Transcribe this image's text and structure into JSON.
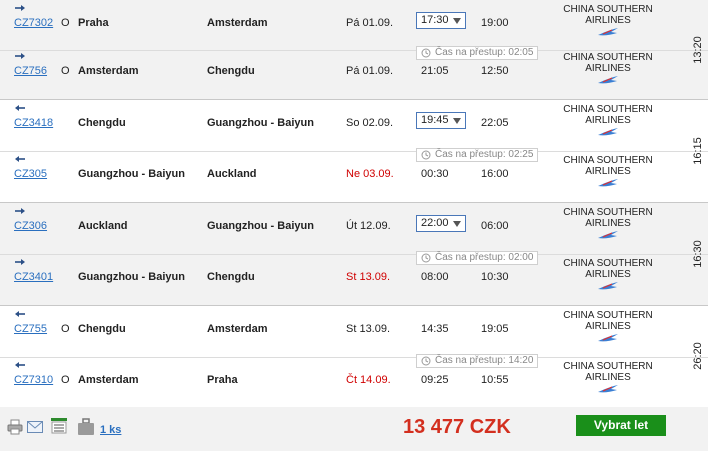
{
  "airline_name": "CHINA SOUTHERN AIRLINES",
  "transfer_label": "Čas na přestup:",
  "legs": [
    {
      "duration": "13:20",
      "segments": [
        {
          "direction": "right",
          "flight": "CZ7302",
          "class": "O",
          "from": "Praha",
          "to": "Amsterdam",
          "date": "Pá 01.09.",
          "date_red": false,
          "dep": "17:30",
          "dep_select": true,
          "arr": "19:00"
        },
        {
          "direction": "right",
          "flight": "CZ756",
          "class": "O",
          "from": "Amsterdam",
          "to": "Chengdu",
          "date": "Pá 01.09.",
          "date_red": false,
          "dep": "21:05",
          "dep_select": false,
          "arr": "12:50"
        }
      ],
      "transfer_time": "02:05"
    },
    {
      "duration": "16:15",
      "segments": [
        {
          "direction": "left",
          "flight": "CZ3418",
          "class": "",
          "from": "Chengdu",
          "to": "Guangzhou - Baiyun",
          "date": "So 02.09.",
          "date_red": false,
          "dep": "19:45",
          "dep_select": true,
          "arr": "22:05"
        },
        {
          "direction": "left",
          "flight": "CZ305",
          "class": "",
          "from": "Guangzhou - Baiyun",
          "to": "Auckland",
          "date": "Ne 03.09.",
          "date_red": true,
          "dep": "00:30",
          "dep_select": false,
          "arr": "16:00"
        }
      ],
      "transfer_time": "02:25"
    },
    {
      "duration": "16:30",
      "segments": [
        {
          "direction": "right",
          "flight": "CZ306",
          "class": "",
          "from": "Auckland",
          "to": "Guangzhou - Baiyun",
          "date": "Út 12.09.",
          "date_red": false,
          "dep": "22:00",
          "dep_select": true,
          "arr": "06:00"
        },
        {
          "direction": "right",
          "flight": "CZ3401",
          "class": "",
          "from": "Guangzhou - Baiyun",
          "to": "Chengdu",
          "date": "St 13.09.",
          "date_red": true,
          "dep": "08:00",
          "dep_select": false,
          "arr": "10:30"
        }
      ],
      "transfer_time": "02:00"
    },
    {
      "duration": "26:20",
      "segments": [
        {
          "direction": "left",
          "flight": "CZ755",
          "class": "O",
          "from": "Chengdu",
          "to": "Amsterdam",
          "date": "St 13.09.",
          "date_red": false,
          "dep": "14:35",
          "dep_select": false,
          "arr": "19:05"
        },
        {
          "direction": "left",
          "flight": "CZ7310",
          "class": "O",
          "from": "Amsterdam",
          "to": "Praha",
          "date": "Čt 14.09.",
          "date_red": true,
          "dep": "09:25",
          "dep_select": false,
          "arr": "10:55"
        }
      ],
      "transfer_time": "14:20"
    }
  ],
  "footer": {
    "count": "1 ks",
    "price": "13 477 CZK",
    "select_label": "Vybrat let"
  },
  "colors": {
    "link": "#2a6fbf",
    "price": "#d32f1f",
    "button": "#1a8f1a",
    "red_date": "#d00000"
  }
}
